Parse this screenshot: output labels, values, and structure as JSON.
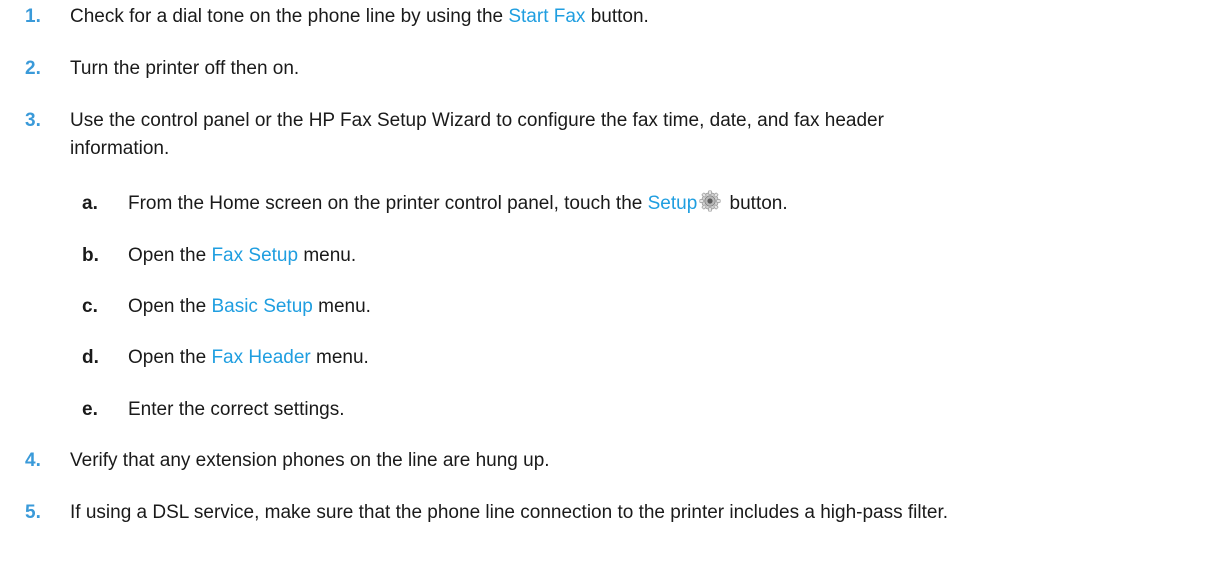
{
  "steps": [
    {
      "number": "1.",
      "before": "Check for a dial tone on the phone line by using the ",
      "link": "Start Fax",
      "after": " button."
    },
    {
      "number": "2.",
      "text": "Turn the printer off then on."
    },
    {
      "number": "3.",
      "line1": "Use the control panel or the HP Fax Setup Wizard to configure the fax time, date, and fax header",
      "line2": "information.",
      "substeps": [
        {
          "label": "a.",
          "before": "From the Home screen on the printer control panel, touch the ",
          "link": "Setup",
          "icon": "gear-icon",
          "after": " button."
        },
        {
          "label": "b.",
          "before": "Open the ",
          "link": "Fax Setup",
          "after": " menu."
        },
        {
          "label": "c.",
          "before": "Open the ",
          "link": "Basic Setup",
          "after": " menu."
        },
        {
          "label": "d.",
          "before": "Open the ",
          "link": "Fax Header",
          "after": " menu."
        },
        {
          "label": "e.",
          "text": "Enter the correct settings."
        }
      ]
    },
    {
      "number": "4.",
      "text": "Verify that any extension phones on the line are hung up."
    },
    {
      "number": "5.",
      "text": "If using a DSL service, make sure that the phone line connection to the printer includes a high-pass filter."
    }
  ],
  "colors": {
    "number": "#3a9ad9",
    "link": "#1f9ee0",
    "text": "#1a1a1a"
  }
}
